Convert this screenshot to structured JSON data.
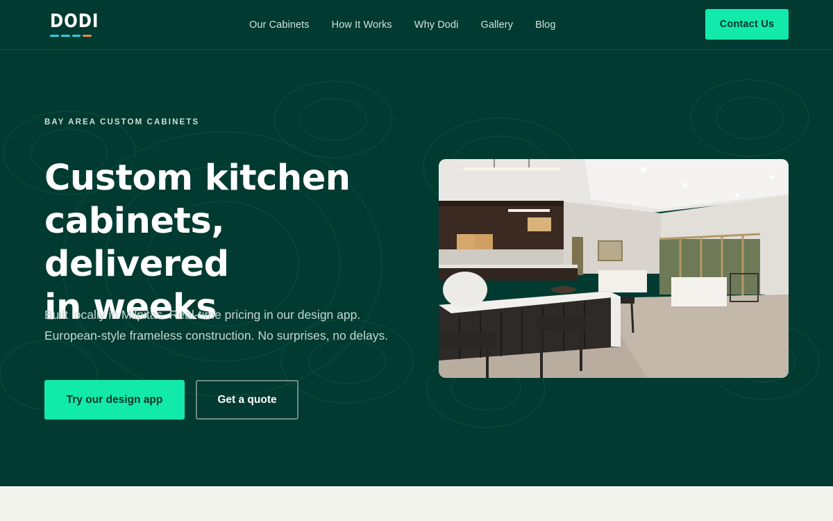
{
  "brand": {
    "logo_text": "DODI",
    "logo_bar_colors": [
      "#2ad1e2",
      "#2ad1e2",
      "#2ad1e2",
      "#f08a3c"
    ]
  },
  "nav": {
    "items": [
      {
        "label": "Our Cabinets"
      },
      {
        "label": "How It Works"
      },
      {
        "label": "Why Dodi"
      },
      {
        "label": "Gallery"
      },
      {
        "label": "Blog"
      }
    ],
    "contact_label": "Contact Us"
  },
  "hero": {
    "eyebrow": "BAY AREA CUSTOM CABINETS",
    "headline_lines": [
      "Custom kitchen",
      "cabinets, delivered",
      "in weeks"
    ],
    "subtext_lines": [
      "Built locally in Milpitas. Real-time pricing in our design app.",
      "European-style frameless construction. No surprises, no delays."
    ],
    "primary_cta": "Try our design app",
    "secondary_cta": "Get a quote"
  },
  "colors": {
    "background": "#003a30",
    "accent": "#12eaa9",
    "footer_strip": "#f3f3ee"
  }
}
